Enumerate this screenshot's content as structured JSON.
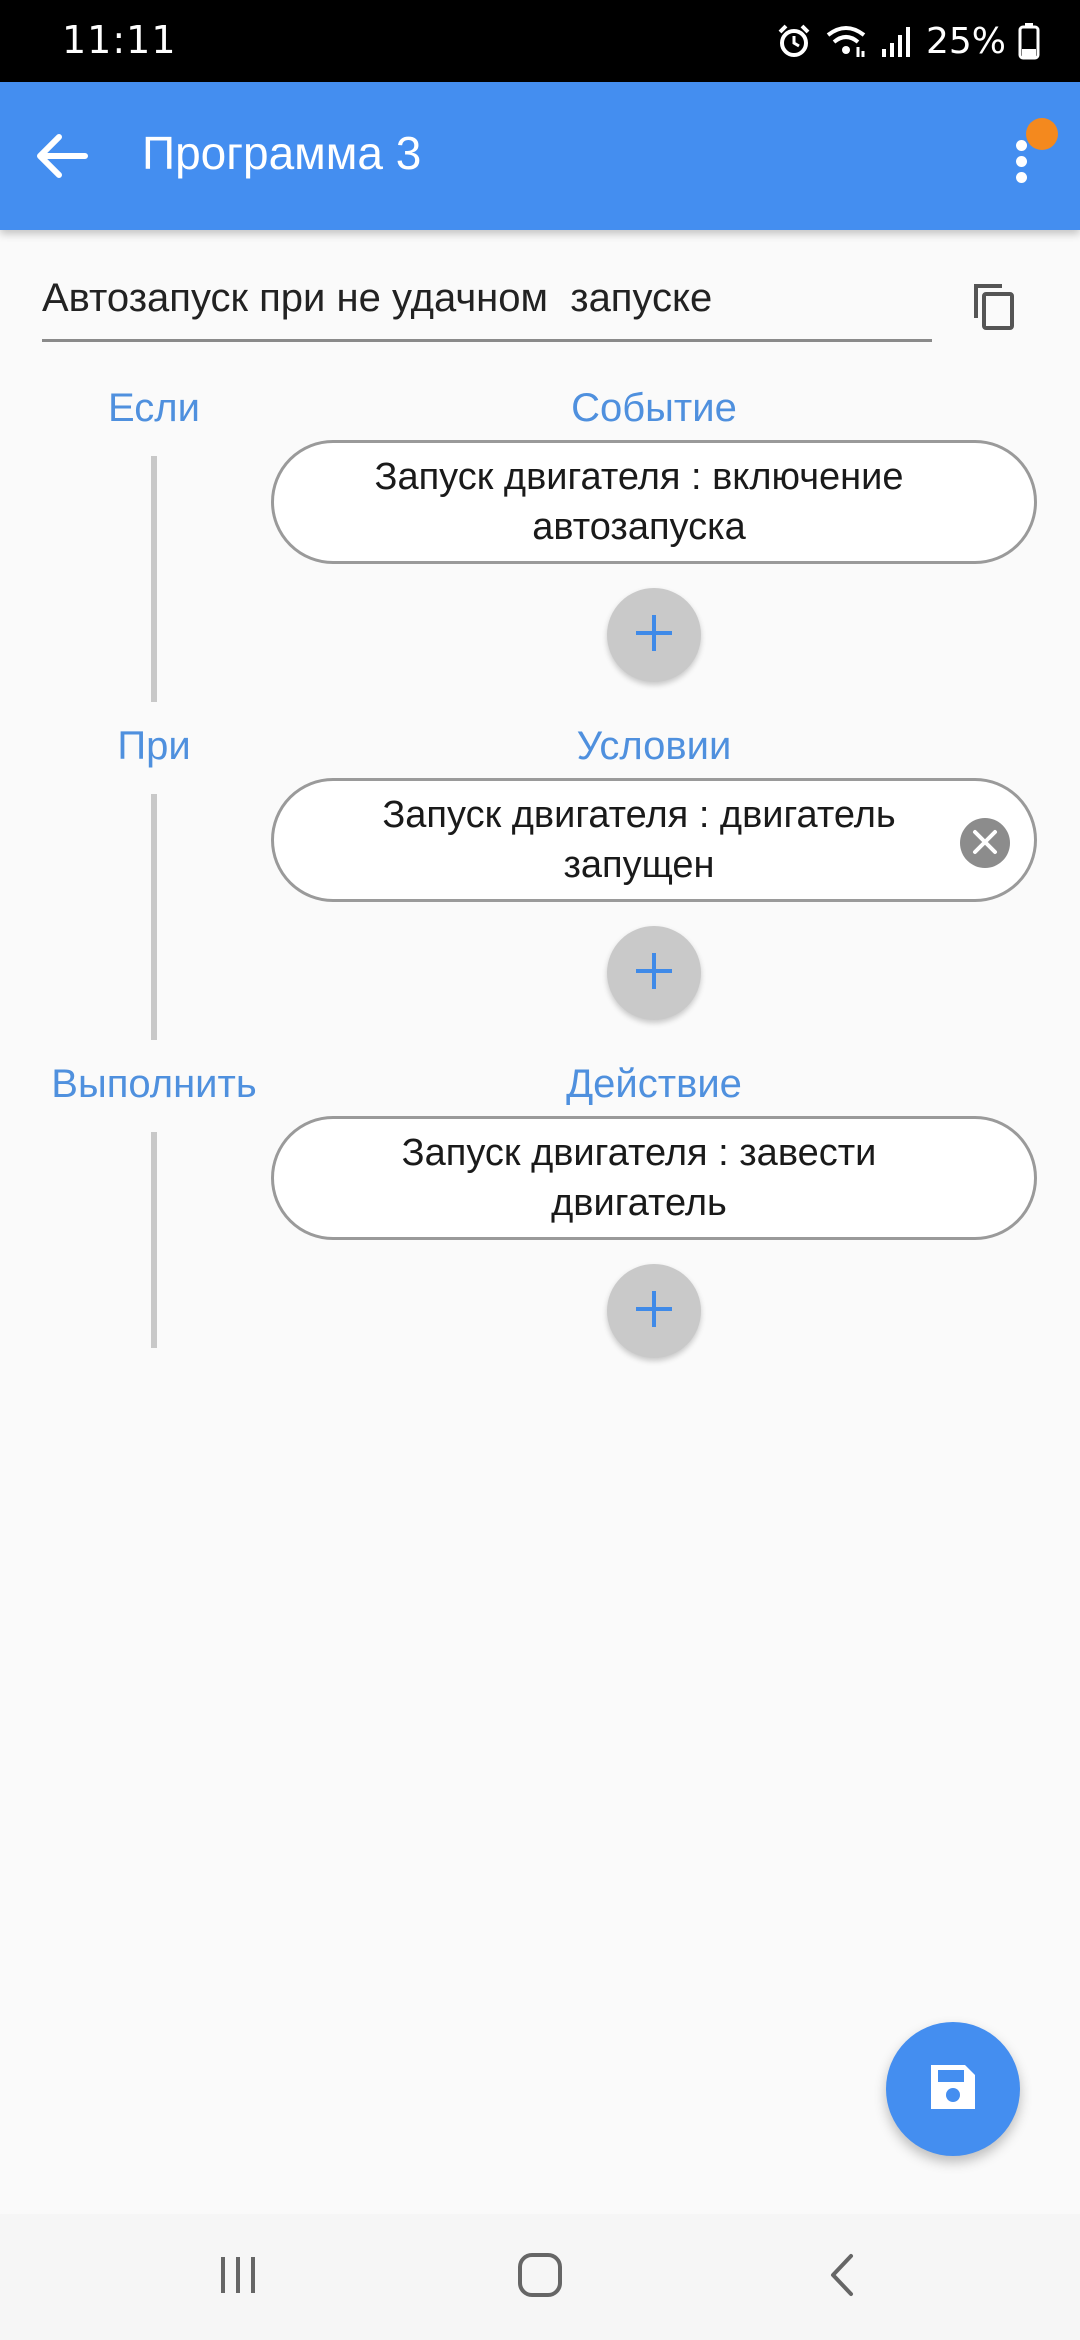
{
  "status_bar": {
    "time": "11:11",
    "battery": "25%",
    "icons": [
      "alarm-icon",
      "wifi-icon",
      "signal-icon",
      "battery-icon"
    ]
  },
  "app_bar": {
    "title": "Программа 3",
    "back_icon": "arrow-left-icon",
    "menu_icon": "more-vert-icon",
    "background": "#448ef0",
    "notification_dot_color": "#f4891e"
  },
  "program": {
    "name": "Автозапуск при не удачном  запуске",
    "copy_icon": "copy-icon"
  },
  "sections": [
    {
      "left_label": "Если",
      "right_label": "Событие",
      "item": "Запуск двигателя : включение автозапуска",
      "removable": false
    },
    {
      "left_label": "При",
      "right_label": "Условии",
      "item": "Запуск двигателя : двигатель запущен",
      "removable": true
    },
    {
      "left_label": "Выполнить",
      "right_label": "Действие",
      "item": "Запуск двигателя : завести двигатель",
      "removable": false
    }
  ],
  "fab": {
    "icon": "save-icon"
  },
  "nav_bar": {
    "icons": [
      "recent-apps-icon",
      "home-icon",
      "back-icon"
    ]
  },
  "colors": {
    "accent": "#448ef0",
    "label": "#4f90de",
    "add_button": "#c9c9c9"
  }
}
